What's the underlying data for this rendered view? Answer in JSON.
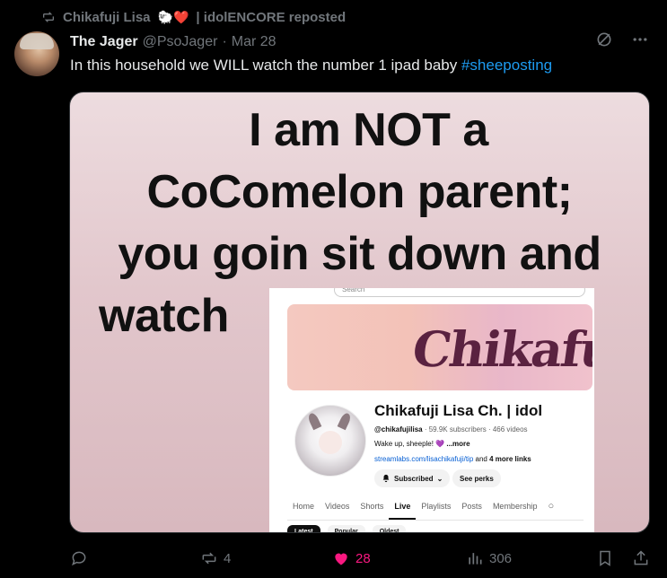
{
  "repost_banner": {
    "icon": "repost-icon",
    "text_name": "Chikafuji Lisa",
    "emojis": "🐑❤️",
    "text_suffix": "| idolENCORE reposted"
  },
  "tweet": {
    "display_name": "The Jager",
    "handle": "@PsoJager",
    "separator": "·",
    "date": "Mar 28",
    "text": "In this household we WILL watch the number 1 ipad baby ",
    "hashtag": "#sheeposting"
  },
  "media": {
    "meme_lines": [
      "I am NOT a",
      "CoComelon parent;",
      "you goin sit down and",
      "watch"
    ],
    "youtube": {
      "search_placeholder": "Search",
      "banner_logo": "Chikafuji",
      "channel_title": "Chikafuji Lisa Ch. | idol",
      "channel_handle": "@chikafujilisa",
      "channel_stats": " · 59.9K subscribers · 466 videos",
      "description": "Wake up, sheeple! ",
      "description_heart": "💜",
      "description_more": " ...more",
      "link_url": "streamlabs.com/lisachikafuji/tip",
      "link_suffix_pre": " and ",
      "link_suffix_bold": "4 more links",
      "subscribed_label": "Subscribed",
      "see_perks_label": "See perks",
      "tabs": [
        "Home",
        "Videos",
        "Shorts",
        "Live",
        "Playlists",
        "Posts",
        "Membership"
      ],
      "active_tab": "Live",
      "chips": [
        "Latest",
        "Popular",
        "Oldest"
      ]
    }
  },
  "actions": {
    "reply_count": "",
    "repost_count": "4",
    "like_count": "28",
    "view_count": "306"
  },
  "colors": {
    "background": "#000000",
    "text": "#e7e9ea",
    "muted": "#71767b",
    "link": "#1d9bf0",
    "like_active": "#f91880"
  }
}
